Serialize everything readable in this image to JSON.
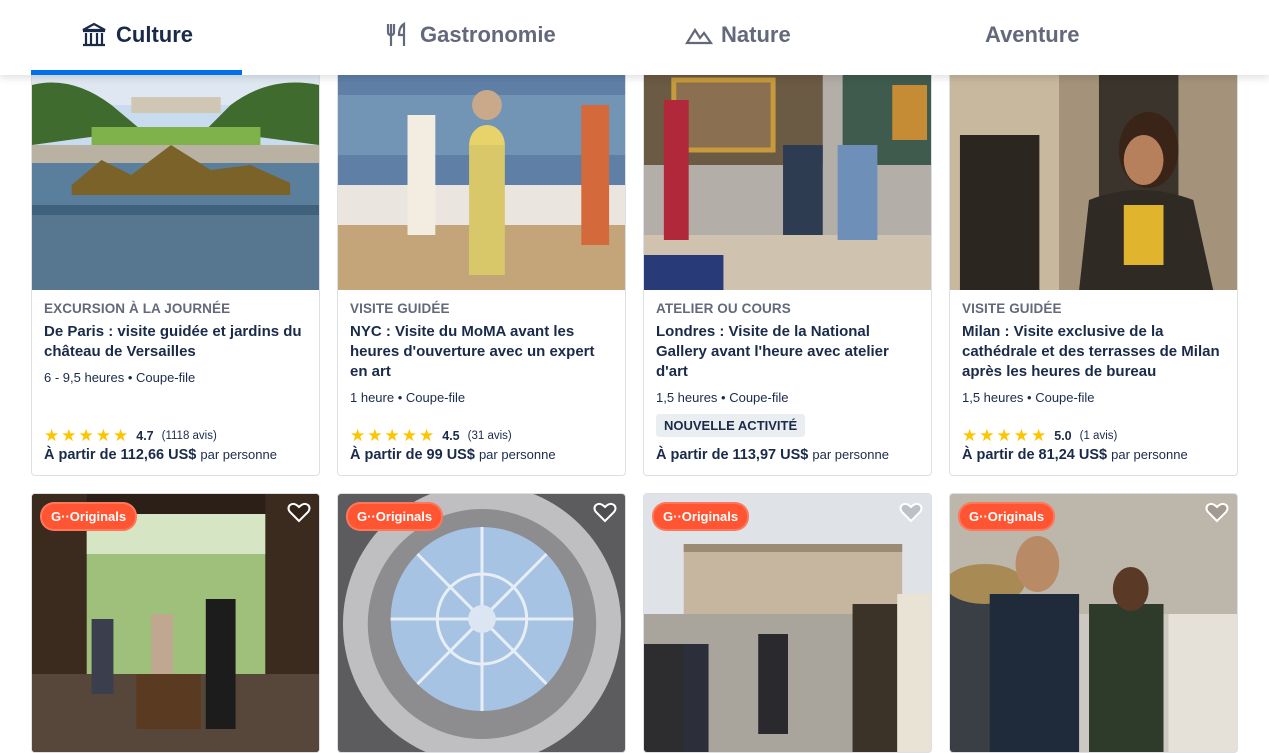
{
  "tabs": [
    {
      "label": "Culture",
      "icon": "museum-icon",
      "active": true
    },
    {
      "label": "Gastronomie",
      "icon": "fork-knife-icon",
      "active": false
    },
    {
      "label": "Nature",
      "icon": "mountain-icon",
      "active": false
    },
    {
      "label": "Aventure",
      "icon": "",
      "active": false
    }
  ],
  "cards": [
    {
      "category": "EXCURSION À LA JOURNÉE",
      "title": "De Paris : visite guidée et jardins du château de Versailles",
      "meta": "6 - 9,5 heures • Coupe-file",
      "rating": "4.7",
      "reviews": "(1118 avis)",
      "price_prefix": "À partir de 112,66 US$",
      "price_suffix": "par personne"
    },
    {
      "category": "VISITE GUIDÉE",
      "title": "NYC : Visite du MoMA avant les heures d'ouverture avec un expert en art",
      "meta": "1 heure • Coupe-file",
      "rating": "4.5",
      "reviews": "(31 avis)",
      "price_prefix": "À partir de 99 US$",
      "price_suffix": "par personne"
    },
    {
      "category": "ATELIER OU COURS",
      "title": "Londres : Visite de la National Gallery avant l'heure avec atelier d'art",
      "meta": "1,5 heures • Coupe-file",
      "badge": "NOUVELLE ACTIVITÉ",
      "price_prefix": "À partir de 113,97 US$",
      "price_suffix": "par personne"
    },
    {
      "category": "VISITE GUIDÉE",
      "title": "Milan : Visite exclusive de la cathédrale et des terrasses de Milan après les heures de bureau",
      "meta": "1,5 heures • Coupe-file",
      "rating": "5.0",
      "reviews": "(1 avis)",
      "price_prefix": "À partir de 81,24 US$",
      "price_suffix": "par personne"
    }
  ],
  "originals": {
    "label": "G··Originals"
  },
  "colors": {
    "accent": "#0071eb",
    "originals": "#ff5533",
    "star": "#fdc500",
    "text": "#1a2b49"
  }
}
